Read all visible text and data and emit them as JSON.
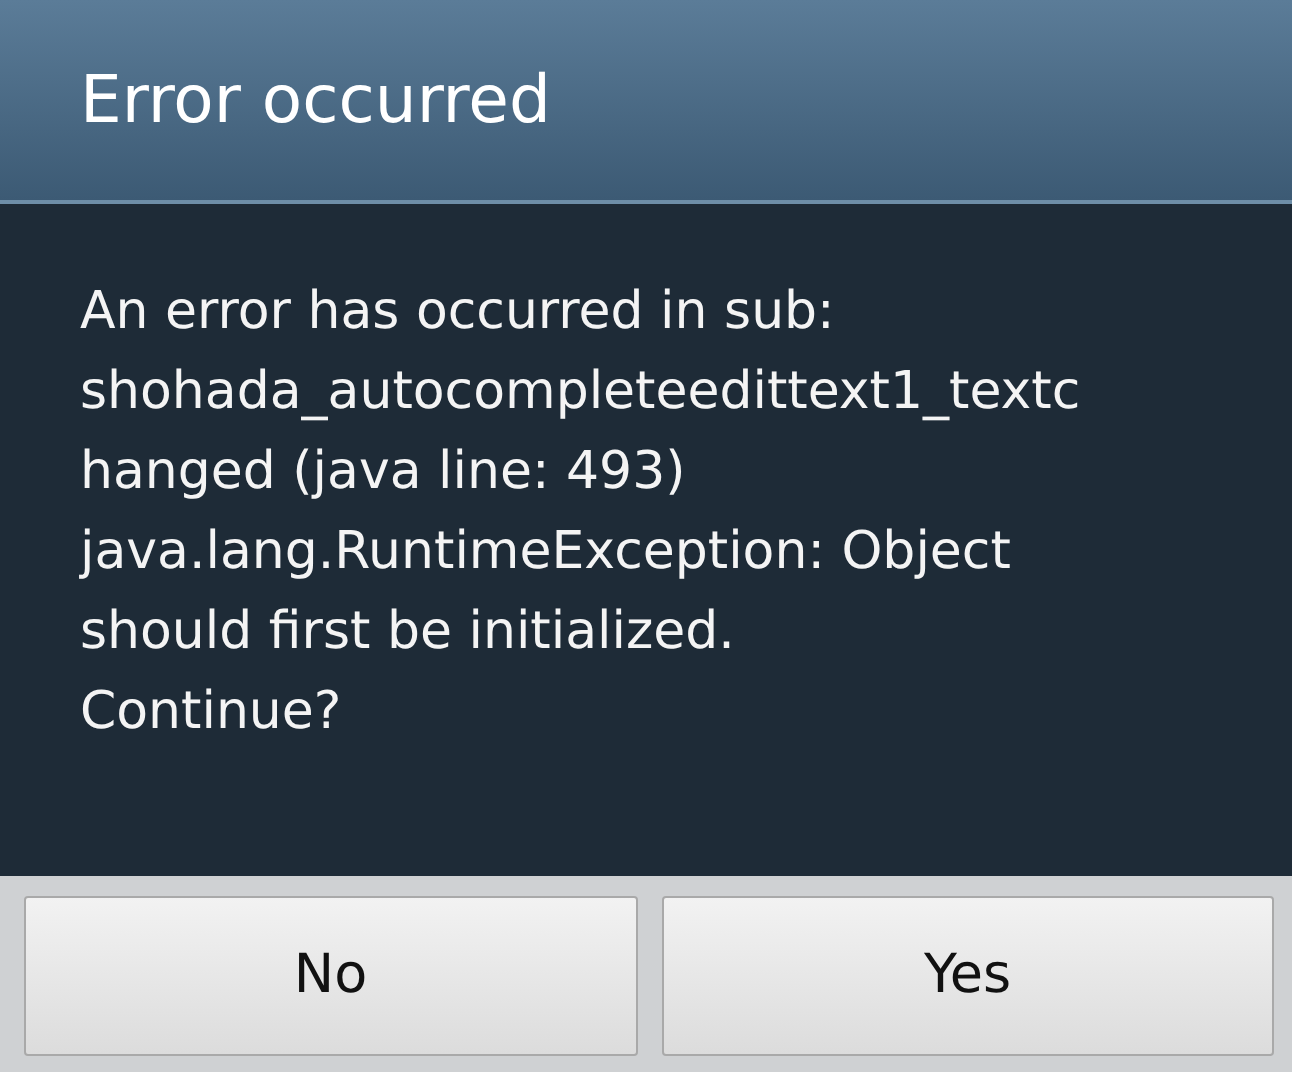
{
  "dialog": {
    "title": "Error occurred",
    "message": "An error has occurred in sub:\nshohada_autocompleteedittext1_textc\nhanged (java line: 493)\njava.lang.RuntimeException: Object\nshould first be initialized.\nContinue?",
    "buttons": [
      "No",
      "Yes"
    ]
  }
}
